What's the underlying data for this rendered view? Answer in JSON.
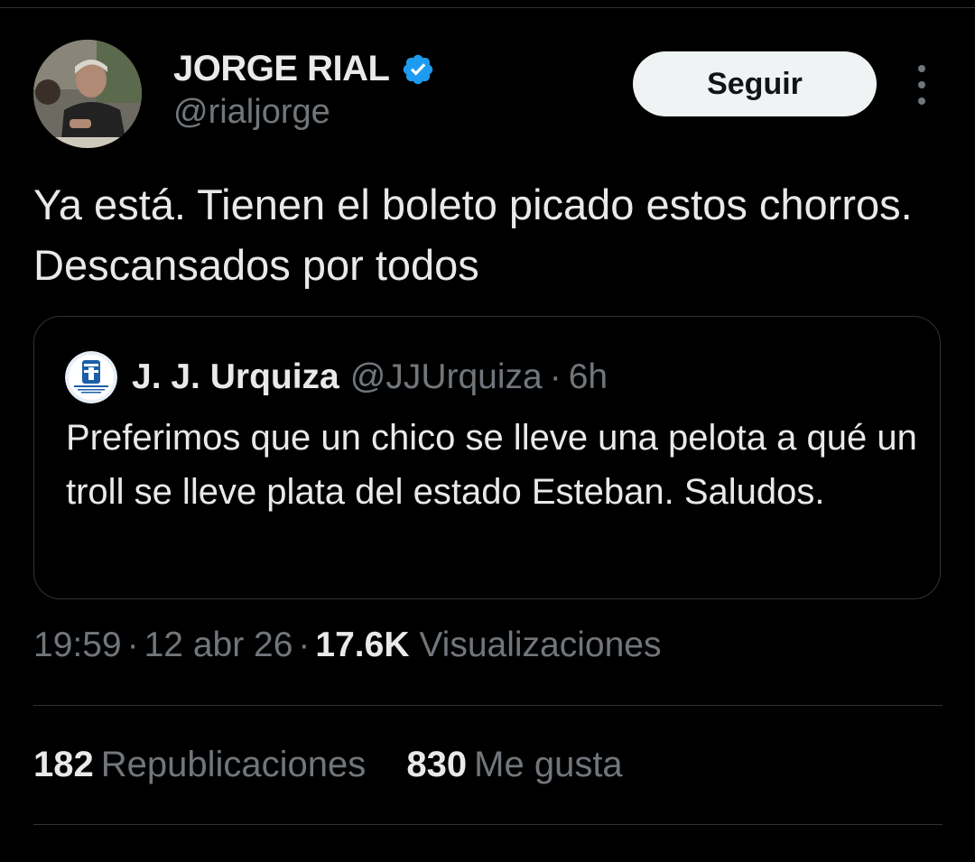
{
  "tweet": {
    "author": {
      "display_name": "JORGE RIAL",
      "handle": "@rialjorge",
      "verified": true,
      "avatar_icon": "profile-photo"
    },
    "follow_label": "Seguir",
    "more_icon": "more-options-icon",
    "text": "Ya está. Tienen el boleto picado estos chorros. Descansados por todos",
    "quoted": {
      "author_name": "J. J. Urquiza",
      "handle": "@JJUrquiza",
      "separator": "·",
      "time": "6h",
      "text": "Preferimos que un chico se lleve una pelota a qué un troll se lleve plata del estado Esteban. Saludos."
    },
    "meta": {
      "time": "19:59",
      "separator": "·",
      "date": "12 abr 26",
      "views_count": "17.6K",
      "views_label": "Visualizaciones"
    },
    "stats": {
      "reposts_count": "182",
      "reposts_label": "Republicaciones",
      "likes_count": "830",
      "likes_label": "Me gusta"
    }
  },
  "colors": {
    "background": "#000000",
    "text_primary": "#e7e9ea",
    "text_secondary": "#71767b",
    "border": "#2f3336",
    "verified_blue": "#1d9bf0",
    "follow_button_bg": "#eff3f4"
  }
}
